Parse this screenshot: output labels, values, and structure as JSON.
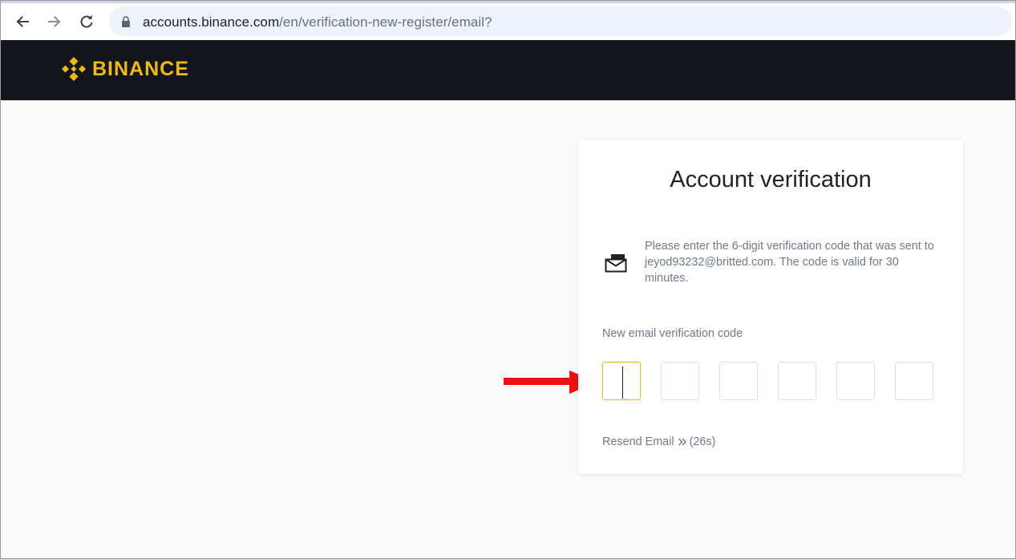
{
  "browser": {
    "url_host": "accounts.binance.com",
    "url_path": "/en/verification-new-register/email?",
    "icons": [
      "back-arrow-icon",
      "forward-arrow-icon",
      "reload-icon",
      "lock-icon"
    ]
  },
  "header": {
    "logo_text": "BINANCE",
    "brand_color": "#f0b90b",
    "background_color": "#12161c"
  },
  "card": {
    "title": "Account verification",
    "info_text": "Please enter the 6-digit verification code that was sent to jeyod93232@britted.com. The code is valid for 30 minutes.",
    "code_label": "New email verification code",
    "code_digits": [
      "",
      "",
      "",
      "",
      "",
      ""
    ],
    "active_box_index": 0,
    "resend_label": "Resend Email",
    "resend_countdown": "(26s)"
  },
  "annotation": {
    "arrow_color": "#ee1111",
    "arrow_target": "first code box"
  }
}
